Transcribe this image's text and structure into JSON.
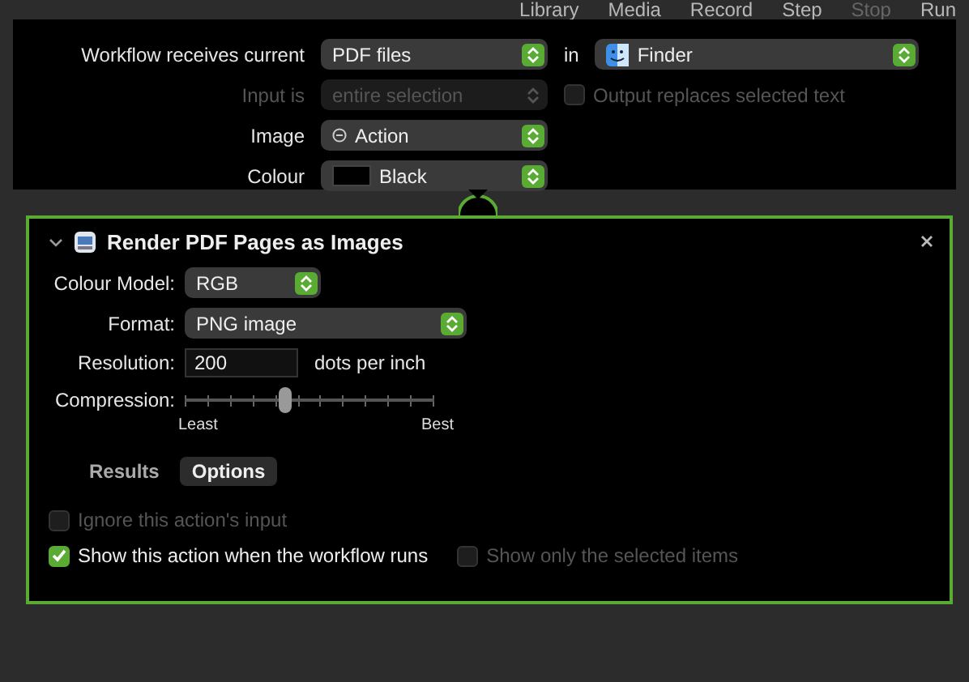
{
  "toolbar": [
    {
      "label": "Library",
      "disabled": false
    },
    {
      "label": "Media",
      "disabled": false
    },
    {
      "label": "Record",
      "disabled": false
    },
    {
      "label": "Step",
      "disabled": false
    },
    {
      "label": "Stop",
      "disabled": true
    },
    {
      "label": "Run",
      "disabled": false
    }
  ],
  "workflow": {
    "receives_label": "Workflow receives current",
    "receives_value": "PDF files",
    "in_label": "in",
    "app_value": "Finder",
    "input_label": "Input is",
    "input_value": "entire selection",
    "input_disabled": true,
    "output_replaces": {
      "label": "Output replaces selected text",
      "checked": false,
      "disabled": true
    },
    "image_label": "Image",
    "image_value": "Action",
    "colour_label": "Colour",
    "colour_value": "Black"
  },
  "action": {
    "title": "Render PDF Pages as Images",
    "expanded": true,
    "colour_model_label": "Colour Model:",
    "colour_model_value": "RGB",
    "format_label": "Format:",
    "format_value": "PNG image",
    "resolution_label": "Resolution:",
    "resolution_value": "200",
    "resolution_unit": "dots per inch",
    "compression_label": "Compression:",
    "compression": {
      "level": 0.4
    },
    "least_label": "Least",
    "best_label": "Best",
    "tabs": [
      {
        "label": "Results",
        "selected": false
      },
      {
        "label": "Options",
        "selected": true
      }
    ],
    "options": [
      {
        "label": "Ignore this action's input",
        "checked": false,
        "disabled": true
      },
      {
        "label": "Show this action when the workflow runs",
        "checked": true,
        "disabled": false
      },
      {
        "label": "Show only the selected items",
        "checked": false,
        "disabled": true
      }
    ]
  }
}
